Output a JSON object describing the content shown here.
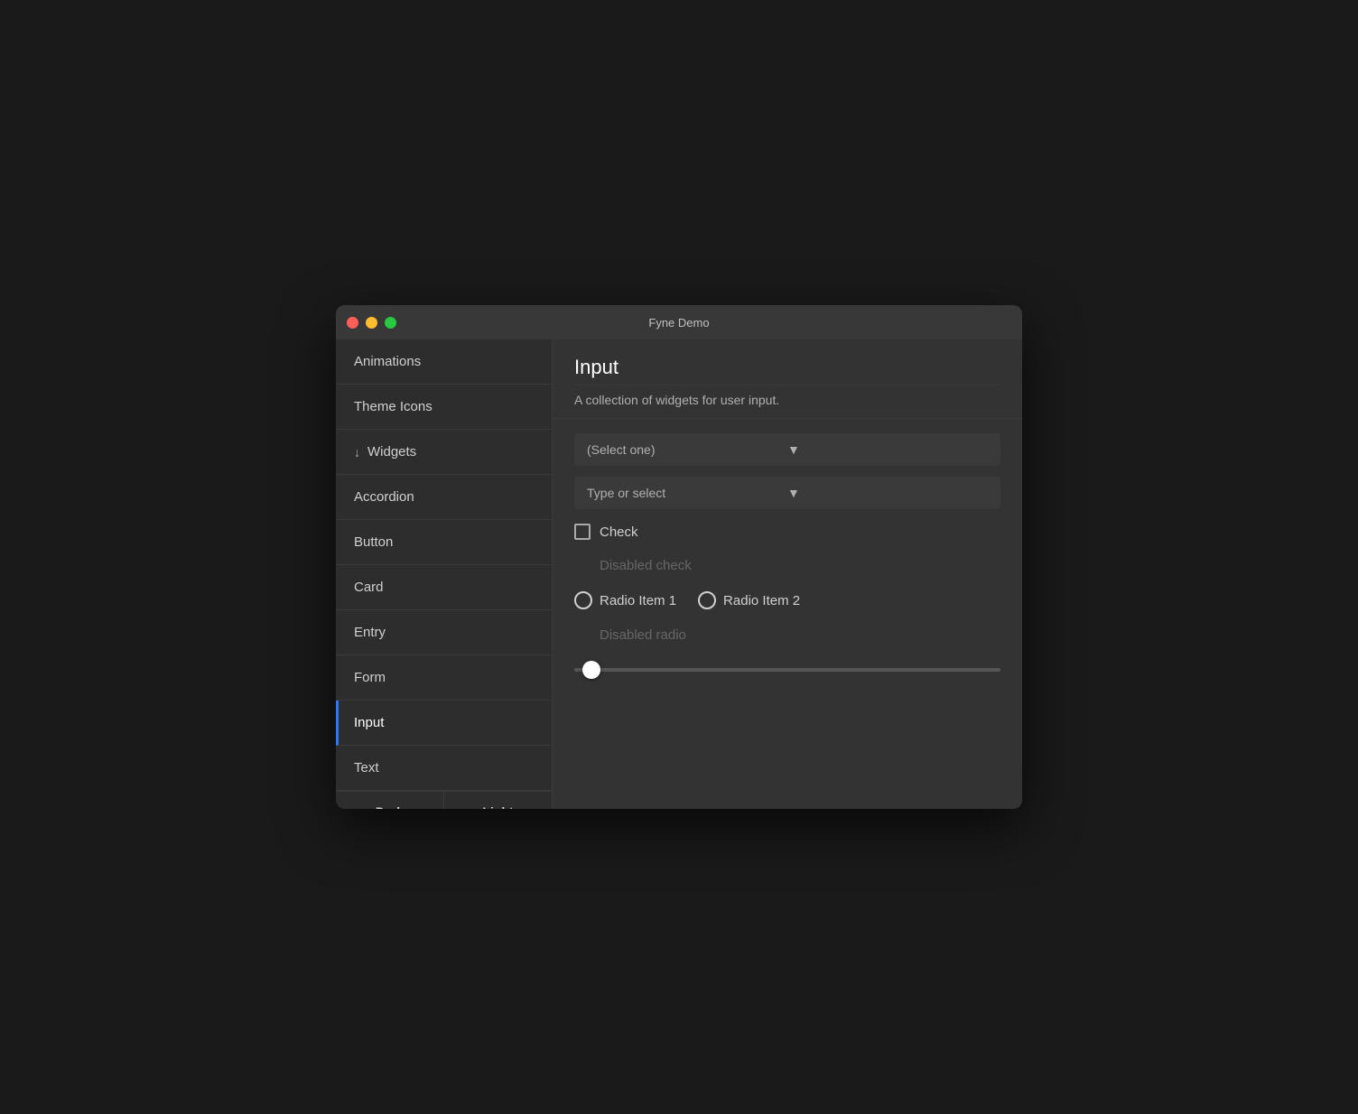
{
  "window": {
    "title": "Fyne Demo"
  },
  "sidebar": {
    "items": [
      {
        "id": "animations",
        "label": "Animations",
        "active": false,
        "has_arrow": false
      },
      {
        "id": "theme-icons",
        "label": "Theme Icons",
        "active": false,
        "has_arrow": false
      },
      {
        "id": "widgets",
        "label": "Widgets",
        "active": false,
        "has_arrow": true,
        "arrow": "↓"
      },
      {
        "id": "accordion",
        "label": "Accordion",
        "active": false,
        "has_arrow": false
      },
      {
        "id": "button",
        "label": "Button",
        "active": false,
        "has_arrow": false
      },
      {
        "id": "card",
        "label": "Card",
        "active": false,
        "has_arrow": false
      },
      {
        "id": "entry",
        "label": "Entry",
        "active": false,
        "has_arrow": false
      },
      {
        "id": "form",
        "label": "Form",
        "active": false,
        "has_arrow": false
      },
      {
        "id": "input",
        "label": "Input",
        "active": true,
        "has_arrow": false
      },
      {
        "id": "text",
        "label": "Text",
        "active": false,
        "has_arrow": false
      }
    ],
    "theme_buttons": [
      {
        "id": "dark",
        "label": "Dark"
      },
      {
        "id": "light",
        "label": "Light"
      }
    ]
  },
  "main": {
    "title": "Input",
    "description": "A collection of widgets for user input.",
    "select_one": {
      "placeholder": "(Select one)",
      "arrow": "▼"
    },
    "type_or_select": {
      "placeholder": "Type or select",
      "arrow": "▼"
    },
    "checkbox": {
      "label": "Check",
      "disabled_label": "Disabled check"
    },
    "radio": {
      "items": [
        {
          "id": "radio1",
          "label": "Radio Item 1"
        },
        {
          "id": "radio2",
          "label": "Radio Item 2"
        }
      ],
      "disabled_label": "Disabled radio"
    },
    "slider": {
      "value": 2
    }
  }
}
